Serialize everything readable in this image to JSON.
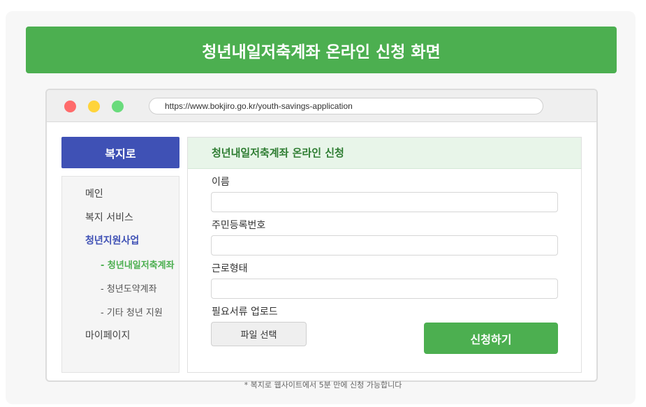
{
  "banner": {
    "title": "청년내일저축계좌 온라인 신청 화면"
  },
  "browser": {
    "url": "https://www.bokjiro.go.kr/youth-savings-application"
  },
  "sidebar": {
    "logo": "복지로",
    "items": [
      {
        "label": "메인",
        "state": "normal"
      },
      {
        "label": "복지 서비스",
        "state": "normal"
      },
      {
        "label": "청년지원사업",
        "state": "active"
      },
      {
        "label": "- 청년내일저축계좌",
        "state": "current"
      },
      {
        "label": "- 청년도약계좌",
        "state": "normal"
      },
      {
        "label": "- 기타 청년 지원",
        "state": "normal"
      },
      {
        "label": "마이페이지",
        "state": "normal"
      }
    ]
  },
  "form": {
    "title": "청년내일저축계좌 온라인 신청",
    "fields": [
      {
        "label": "이름",
        "value": "",
        "placeholder": ""
      },
      {
        "label": "주민등록번호",
        "value": "",
        "placeholder": ""
      },
      {
        "label": "근로형태",
        "value": "",
        "placeholder": ""
      }
    ],
    "upload_label": "필요서류 업로드",
    "file_button": "파일 선택",
    "submit_button": "신청하기"
  },
  "footnote": "* 복지로 웹사이트에서 5분 만에 신청 가능합니다",
  "colors": {
    "brand_green": "#4caf50",
    "brand_blue": "#3f51b5",
    "header_green_text": "#2e7d32"
  }
}
